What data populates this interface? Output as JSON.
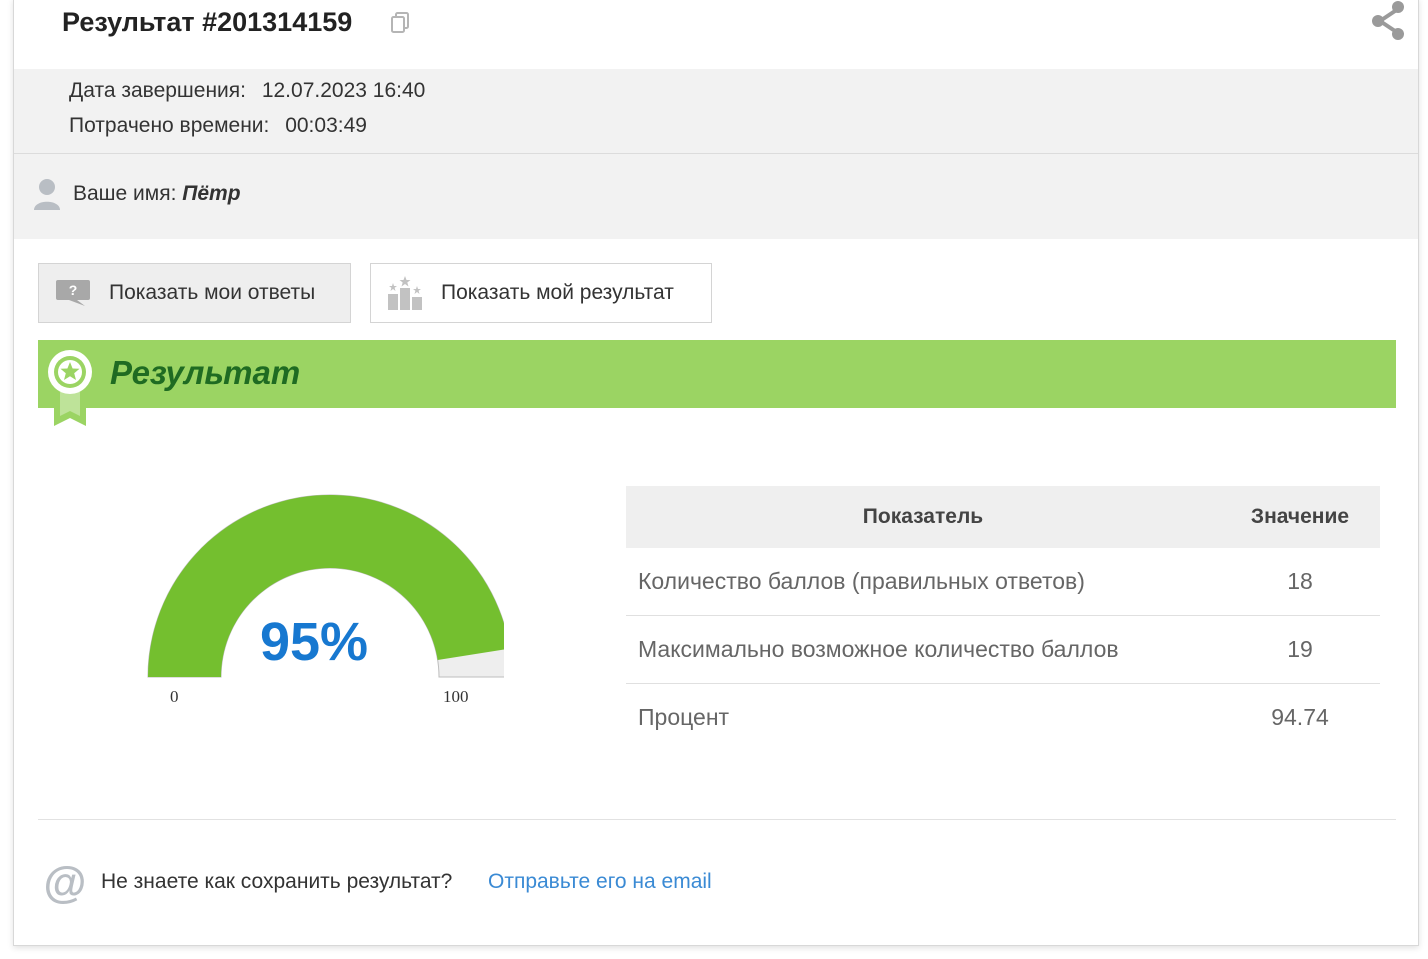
{
  "header": {
    "title": "Результат #201314159"
  },
  "meta": {
    "completion_label": "Дата завершения:",
    "completion_value": "12.07.2023 16:40",
    "time_label": "Потрачено времени:",
    "time_value": "00:03:49"
  },
  "user": {
    "label": "Ваше имя:",
    "name": "Пётр"
  },
  "buttons": {
    "show_answers": "Показать мои ответы",
    "show_result": "Показать мой результат"
  },
  "banner": {
    "title": "Результат"
  },
  "gauge": {
    "value_text": "95%",
    "percent": 95,
    "min": "0",
    "max": "100",
    "colors": {
      "fill": "#74bf2f",
      "track": "#eeeeee"
    }
  },
  "stats": {
    "headers": [
      "Показатель",
      "Значение"
    ],
    "rows": [
      [
        "Количество баллов (правильных ответов)",
        "18"
      ],
      [
        "Максимально возможное количество баллов",
        "19"
      ],
      [
        "Процент",
        "94.74"
      ]
    ]
  },
  "footer": {
    "question": "Не знаете как сохранить результат?",
    "link": "Отправьте его на email"
  }
}
